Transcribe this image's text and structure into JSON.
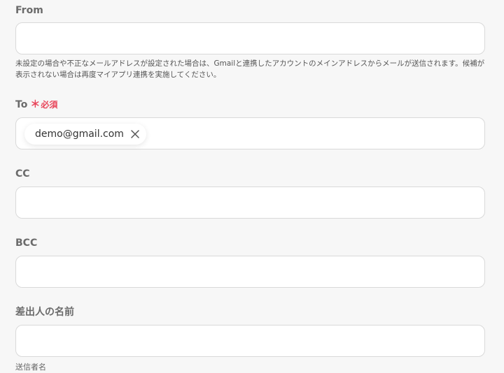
{
  "fields": {
    "from": {
      "label": "From",
      "value": "",
      "help": "未設定の場合や不正なメールアドレスが設定された場合は、Gmailと連携したアカウントのメインアドレスからメールが送信されます。候補が表示されない場合は再度マイアプリ連携を実施してください。"
    },
    "to": {
      "label": "To",
      "required_mark": "＊",
      "required_text": "必須",
      "chips": [
        {
          "text": "demo@gmail.com",
          "icon": "close-icon"
        }
      ]
    },
    "cc": {
      "label": "CC",
      "value": ""
    },
    "bcc": {
      "label": "BCC",
      "value": ""
    },
    "sender_name": {
      "label": "差出人の名前",
      "value": "",
      "help": "送信者名"
    }
  },
  "colors": {
    "required": "#e8455a",
    "input_border": "#d9d9d9",
    "background": "#f7f7f7"
  }
}
